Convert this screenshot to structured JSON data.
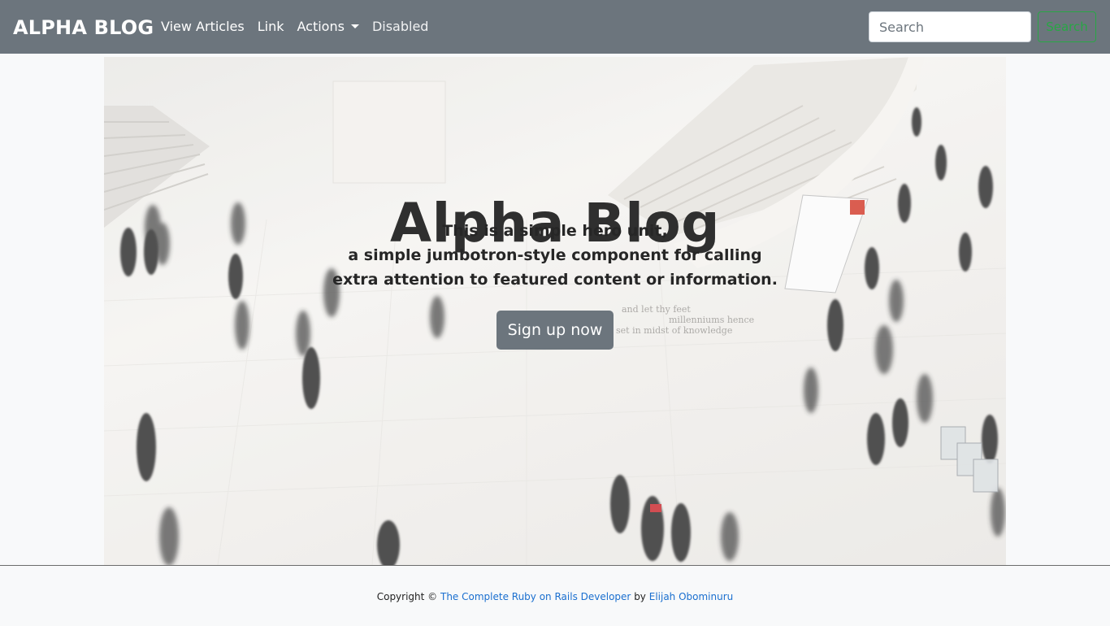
{
  "navbar": {
    "brand": "ALPHA BLOG",
    "items": [
      {
        "label": "View Articles"
      },
      {
        "label": "Link"
      },
      {
        "label": "Actions"
      },
      {
        "label": "Disabled"
      }
    ],
    "search": {
      "placeholder": "Search",
      "button_label": "Search"
    }
  },
  "hero": {
    "title": "Alpha Blog",
    "lead_lines": [
      "This is a simple hero unit,",
      "a simple jumbotron-style component for calling",
      "extra attention to featured content or information."
    ],
    "background_text": [
      "and let thy feet",
      "millenniums hence",
      "set in midst of knowledge"
    ],
    "signup_label": "Sign up now"
  },
  "footer": {
    "prefix": "Copyright ©",
    "course_link": "The Complete Ruby on Rails Developer",
    "by": "by",
    "author_link": "Elijah Obominuru"
  },
  "colors": {
    "navbar_bg": "#6c757d",
    "page_bg": "#f8f9fa",
    "search_button": "#28a745",
    "link": "#1a6fcf",
    "signup_button": "#6c757d"
  }
}
